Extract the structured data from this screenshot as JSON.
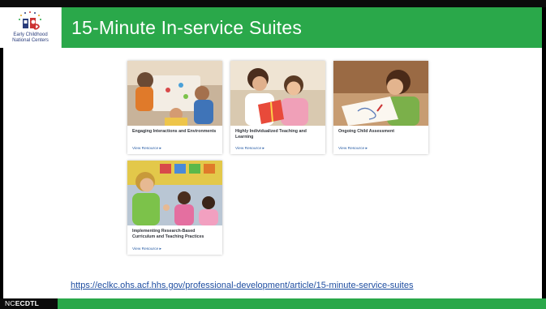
{
  "header": {
    "title": "15-Minute In-service Suites",
    "logo_text_line1": "Early Childhood",
    "logo_text_line2": "National Centers"
  },
  "cards": [
    {
      "title": "Engaging Interactions and Environments",
      "link_label": "View Resource ▸"
    },
    {
      "title": "Highly Individualized Teaching and Learning",
      "link_label": "View Resource ▸"
    },
    {
      "title": "Ongoing Child Assessment",
      "link_label": "View Resource ▸"
    },
    {
      "title": "Implementing Research-Based Curriculum and Teaching Practices",
      "link_label": "View Resource ▸"
    }
  ],
  "url": "https://eclkc.ohs.acf.hhs.gov/professional-development/article/15-minute-service-suites",
  "footer": {
    "prefix": "NC",
    "brand": "ECDTL"
  },
  "colors": {
    "green": "#2aa84a",
    "link": "#1f4ea1",
    "black": "#0b0b0b"
  }
}
